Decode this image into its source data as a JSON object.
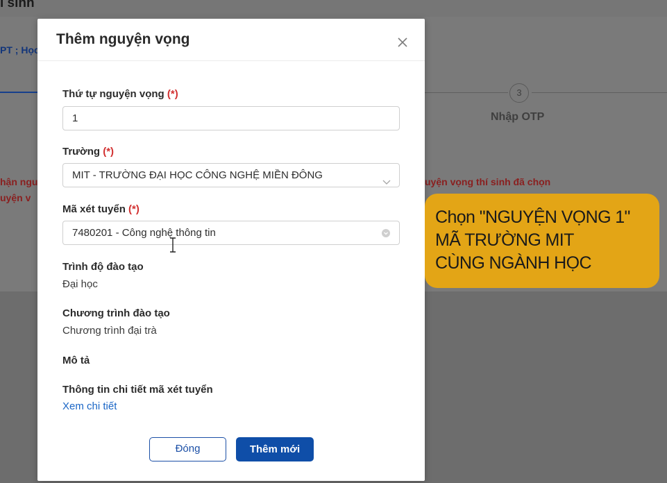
{
  "background": {
    "page_title": "ı sinh",
    "breadcrumb": "PT ; Học",
    "step": {
      "number": "3",
      "label": "Nhập OTP"
    },
    "warning_left_1": "hận ngu",
    "warning_left_2": "uyện v",
    "warning_right": "uyện vọng thí sinh đã chọn"
  },
  "modal": {
    "title": "Thêm nguyện vọng",
    "close_icon": "close-icon",
    "fields": {
      "order": {
        "label": "Thứ tự nguyện vọng",
        "required_mark": "(*)",
        "value": "1"
      },
      "school": {
        "label": "Trường",
        "required_mark": "(*)",
        "value": "MIT - TRƯỜNG ĐẠI HỌC CÔNG NGHỆ MIỀN ĐÔNG",
        "icon": "chevron-down-icon"
      },
      "admission_code": {
        "label": "Mã xét tuyển",
        "required_mark": "(*)",
        "value": "7480201 - Công nghệ thông tin",
        "icon": "dropdown-icon"
      }
    },
    "info": {
      "training_level": {
        "label": "Trình độ đào tạo",
        "value": "Đại học"
      },
      "program": {
        "label": "Chương trình đào tạo",
        "value": "Chương trình đại trà"
      },
      "description": {
        "label": "Mô tả"
      },
      "details": {
        "label": "Thông tin chi tiết mã xét tuyển",
        "link": "Xem chi tiết"
      }
    },
    "buttons": {
      "close": "Đóng",
      "add": "Thêm mới"
    }
  },
  "callout": {
    "lines": [
      "Chọn \"NGUYỆN VỌNG 1\"",
      "MÃ TRƯỜNG MIT",
      "CÙNG NGÀNH HỌC"
    ]
  },
  "colors": {
    "accent": "#0f4ea8",
    "required": "#d23030",
    "link": "#1a66c6",
    "callout": "#e3a516"
  }
}
